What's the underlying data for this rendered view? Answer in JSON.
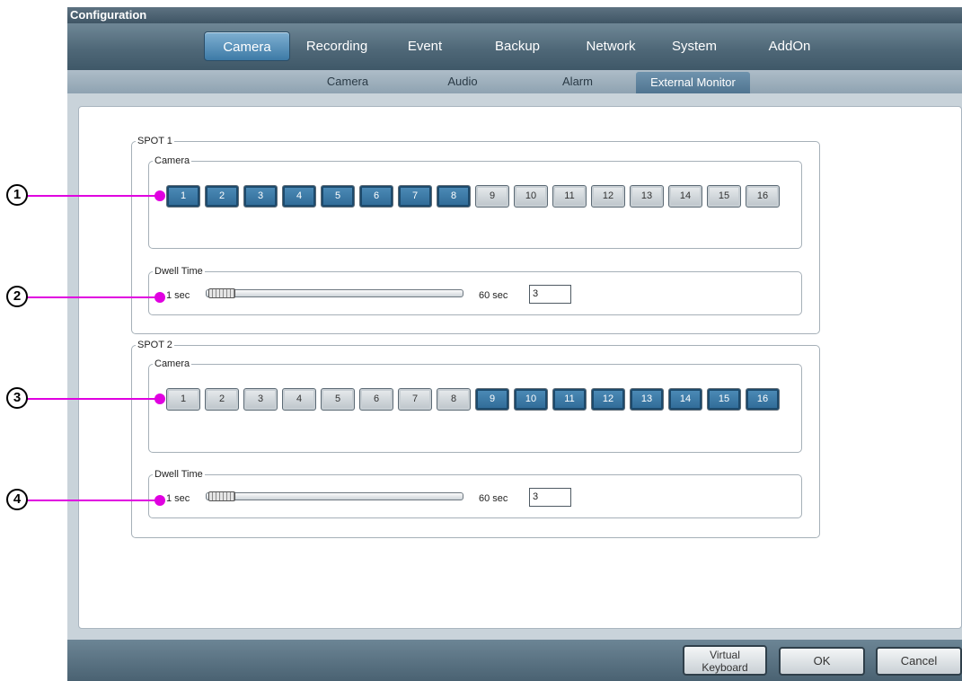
{
  "window": {
    "title": "Configuration"
  },
  "top_tabs": [
    {
      "label": "Camera",
      "active": true
    },
    {
      "label": "Recording",
      "active": false
    },
    {
      "label": "Event",
      "active": false
    },
    {
      "label": "Backup",
      "active": false
    },
    {
      "label": "Network",
      "active": false
    },
    {
      "label": "System",
      "active": false
    },
    {
      "label": "AddOn",
      "active": false
    }
  ],
  "sub_tabs": [
    {
      "label": "Camera",
      "active": false
    },
    {
      "label": "Audio",
      "active": false
    },
    {
      "label": "Alarm",
      "active": false
    },
    {
      "label": "External Monitor",
      "active": true
    }
  ],
  "spots": [
    {
      "label": "SPOT 1",
      "camera_label": "Camera",
      "cameras": [
        {
          "label": "1",
          "selected": true
        },
        {
          "label": "2",
          "selected": true
        },
        {
          "label": "3",
          "selected": true
        },
        {
          "label": "4",
          "selected": true
        },
        {
          "label": "5",
          "selected": true
        },
        {
          "label": "6",
          "selected": true
        },
        {
          "label": "7",
          "selected": true
        },
        {
          "label": "8",
          "selected": true
        },
        {
          "label": "9",
          "selected": false
        },
        {
          "label": "10",
          "selected": false
        },
        {
          "label": "11",
          "selected": false
        },
        {
          "label": "12",
          "selected": false
        },
        {
          "label": "13",
          "selected": false
        },
        {
          "label": "14",
          "selected": false
        },
        {
          "label": "15",
          "selected": false
        },
        {
          "label": "16",
          "selected": false
        }
      ],
      "dwell_label": "Dwell Time",
      "dwell_min": "1 sec",
      "dwell_max": "60 sec",
      "dwell_value": "3"
    },
    {
      "label": "SPOT 2",
      "camera_label": "Camera",
      "cameras": [
        {
          "label": "1",
          "selected": false
        },
        {
          "label": "2",
          "selected": false
        },
        {
          "label": "3",
          "selected": false
        },
        {
          "label": "4",
          "selected": false
        },
        {
          "label": "5",
          "selected": false
        },
        {
          "label": "6",
          "selected": false
        },
        {
          "label": "7",
          "selected": false
        },
        {
          "label": "8",
          "selected": false
        },
        {
          "label": "9",
          "selected": true
        },
        {
          "label": "10",
          "selected": true
        },
        {
          "label": "11",
          "selected": true
        },
        {
          "label": "12",
          "selected": true
        },
        {
          "label": "13",
          "selected": true
        },
        {
          "label": "14",
          "selected": true
        },
        {
          "label": "15",
          "selected": true
        },
        {
          "label": "16",
          "selected": true
        }
      ],
      "dwell_label": "Dwell Time",
      "dwell_min": "1 sec",
      "dwell_max": "60 sec",
      "dwell_value": "3"
    }
  ],
  "buttons": {
    "virtual_keyboard_line1": "Virtual",
    "virtual_keyboard_line2": "Keyboard",
    "ok": "OK",
    "cancel": "Cancel"
  },
  "callouts": [
    "1",
    "2",
    "3",
    "4"
  ],
  "colors": {
    "callout": "#e000e0",
    "selected_camera": "#2f6a96"
  }
}
